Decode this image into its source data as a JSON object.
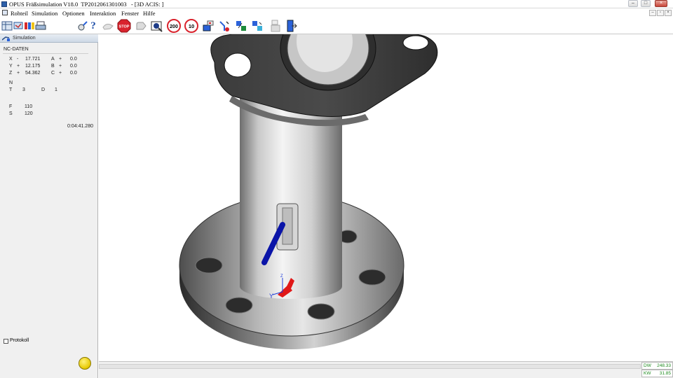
{
  "window": {
    "title": "OPUS Fräßsimulation V18.0  TP2012061301003   - [3D ACIS: ]",
    "minimize": "–",
    "maximize": "□",
    "close": "×",
    "mdi_minimize": "–",
    "mdi_restore": "▫",
    "mdi_close": "×"
  },
  "menu": {
    "items": [
      "Rohteil",
      "Simulation",
      "Optionen",
      "Interaktion",
      "Fenster",
      "Hilfe"
    ]
  },
  "toolbar": {
    "icons": [
      "blank-part-icon",
      "measure-icon",
      "color-icon",
      "print-icon",
      "tool-settings-icon",
      "help-icon",
      "rewind-hand-icon",
      "stop-icon",
      "pause-hand-icon",
      "zoom-view-icon",
      "speed-200-icon",
      "speed-10-icon",
      "cut-control-icon",
      "tool-path-icon",
      "tool-change-icon",
      "tool-change-2-icon",
      "save-icon",
      "exit-icon"
    ],
    "stop_label": "STOP",
    "speed_200": "200",
    "speed_10": "10",
    "help_label": "?"
  },
  "panel": {
    "tab_label": "Simulation",
    "nc_header": "NC-DATEN",
    "rows": [
      {
        "a_label": "X",
        "a_op": "-",
        "a_value": "17.721",
        "b_label": "A",
        "b_op": "+",
        "b_value": "0.0"
      },
      {
        "a_label": "Y",
        "a_op": "+",
        "a_value": "12.175",
        "b_label": "B",
        "b_op": "+",
        "b_value": "0.0"
      },
      {
        "a_label": "Z",
        "a_op": "+",
        "a_value": "54.362",
        "b_label": "C",
        "b_op": "+",
        "b_value": "0.0"
      }
    ],
    "n_label": "N",
    "t_label": "T",
    "t_value": "3",
    "d_label": "D",
    "d_value": "1",
    "f_label": "F",
    "f_value": "110",
    "s_label": "S",
    "s_value": "120",
    "time": "0:04:41.280",
    "protokoll_label": "Protokoll",
    "protokoll_checked": false
  },
  "status": {
    "dw_label": "DW",
    "dw_value": "248.33",
    "kw_label": "KW",
    "kw_value": "31.85"
  },
  "viewport": {
    "axis_x": "X",
    "axis_y": "Y",
    "axis_z": "Z"
  },
  "colors": {
    "title_icon": "#2d5fa8",
    "stop_red": "#d9232d",
    "status_green": "#1d8a1d",
    "tool_blue": "#0a14a8",
    "axis_red": "#e01818"
  }
}
